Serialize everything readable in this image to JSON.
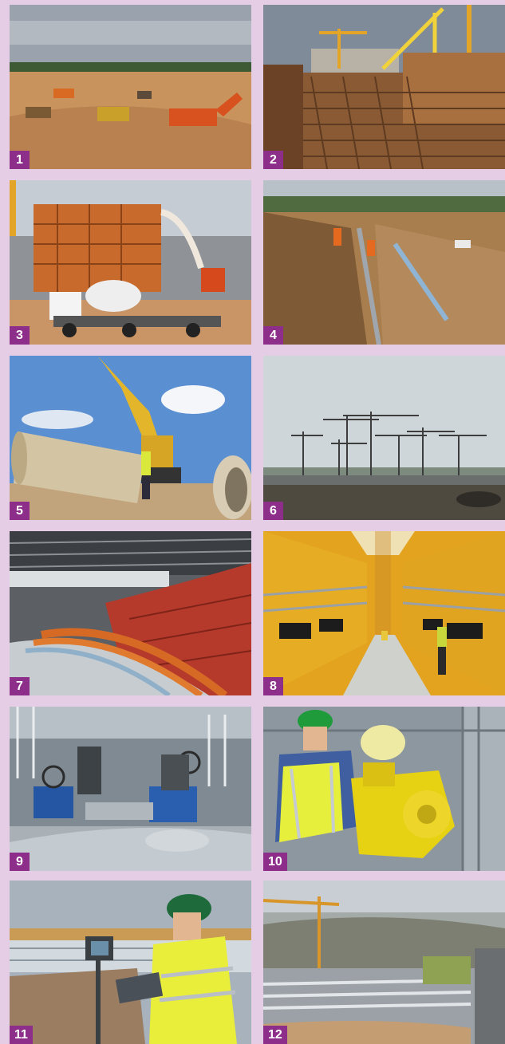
{
  "photos": [
    {
      "number": "1",
      "scene": "earthworks-excavators-dump-trucks"
    },
    {
      "number": "2",
      "scene": "rebar-cages-tower-cranes"
    },
    {
      "number": "3",
      "scene": "concrete-mixer-truck-pump-formwork"
    },
    {
      "number": "4",
      "scene": "trench-pipe-laying-workers"
    },
    {
      "number": "5",
      "scene": "large-pipe-lifted-by-excavator"
    },
    {
      "number": "6",
      "scene": "tower-cranes-skyline"
    },
    {
      "number": "7",
      "scene": "orange-cables-tray-red-wall"
    },
    {
      "number": "8",
      "scene": "yellow-tanks-corridor-pumps"
    },
    {
      "number": "9",
      "scene": "blue-valves-steel-pipes"
    },
    {
      "number": "10",
      "scene": "worker-green-helmet-yellow-pump"
    },
    {
      "number": "11",
      "scene": "worker-with-tablet-green-helmet"
    },
    {
      "number": "12",
      "scene": "crane-over-treatment-plant"
    }
  ],
  "colors": {
    "background": "#e6cde6",
    "badge": "#8d2f8a",
    "badge_text": "#ffffff"
  }
}
